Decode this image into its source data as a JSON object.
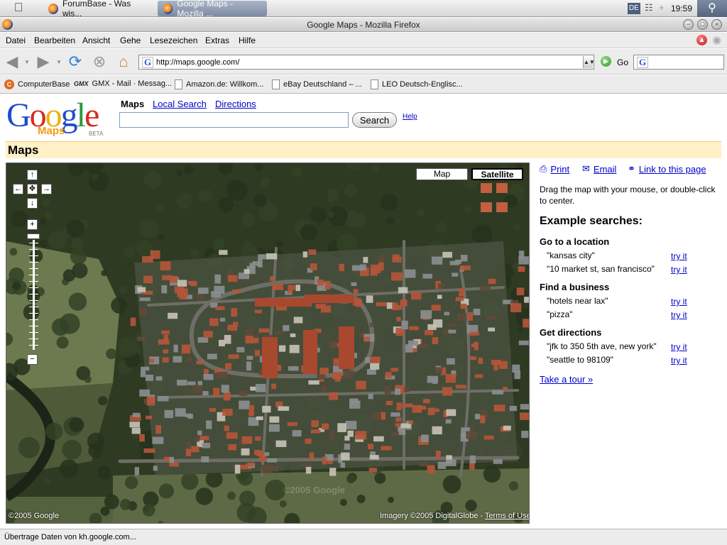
{
  "os": {
    "tabs": [
      "ForumBase - Was wis...",
      "Google Maps - Mozilla ..."
    ],
    "lang": "DE",
    "clock": "19:59"
  },
  "window": {
    "title": "Google Maps - Mozilla Firefox"
  },
  "menu": [
    "Datei",
    "Bearbeiten",
    "Ansicht",
    "Gehe",
    "Lesezeichen",
    "Extras",
    "Hilfe"
  ],
  "nav": {
    "url": "http://maps.google.com/",
    "go_label": "Go"
  },
  "bookmarks": [
    "ComputerBase",
    "GMX - Mail · Messag...",
    "Amazon.de: Willkom...",
    "eBay Deutschland – ...",
    "LEO Deutsch-Englisc..."
  ],
  "header": {
    "logo_word": "Google",
    "logo_sub": "Maps",
    "logo_beta": "BETA",
    "tab_maps": "Maps",
    "tab_local": "Local Search",
    "tab_directions": "Directions",
    "search_value": "",
    "search_button": "Search",
    "help": "Help",
    "section_title": "Maps"
  },
  "map": {
    "type_map": "Map",
    "type_satellite": "Satellite",
    "selected_type": "Satellite",
    "copyright": "©2005 Google",
    "imagery": "Imagery ©2005 DigitalGlobe - ",
    "terms": "Terms of Use",
    "watermark": "©2005 Google"
  },
  "panel": {
    "print": "Print",
    "email": "Email",
    "link": "Link to this page",
    "instructions": "Drag the map with your mouse, or double-click to center.",
    "examples_title": "Example searches:",
    "sections": [
      {
        "title": "Go to a location",
        "examples": [
          "\"kansas city\"",
          "\"10 market st, san francisco\""
        ]
      },
      {
        "title": "Find a business",
        "examples": [
          "\"hotels near lax\"",
          "\"pizza\""
        ]
      },
      {
        "title": "Get directions",
        "examples": [
          "\"jfk to 350 5th ave, new york\"",
          "\"seattle to 98109\""
        ]
      }
    ],
    "try_label": "try it",
    "tour": "Take a tour »"
  },
  "status": {
    "text": "Übertrage Daten von kh.google.com..."
  },
  "colors": {
    "link": "#0000cc",
    "maps_bar_bg": "#fff0c6",
    "map_vegetation": "#2c3a20",
    "roof_red": "#b4553a"
  }
}
